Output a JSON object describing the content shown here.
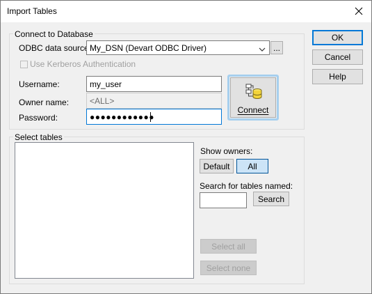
{
  "window": {
    "title": "Import Tables"
  },
  "dialog_buttons": {
    "ok": "OK",
    "cancel": "Cancel",
    "help": "Help"
  },
  "connect_group": {
    "title": "Connect to Database",
    "odbc_label": "ODBC data source:",
    "odbc_value": "My_DSN (Devart ODBC Driver)",
    "browse_label": "...",
    "kerberos_label": "Use Kerberos Authentication",
    "kerberos_checked": false,
    "username_label": "Username:",
    "username_value": "my_user",
    "owner_label": "Owner name:",
    "owner_value": "<ALL>",
    "password_label": "Password:",
    "password_mask": "●●●●●●●●●●●●",
    "connect_label": "Connect"
  },
  "select_group": {
    "title": "Select tables",
    "show_owners_label": "Show owners:",
    "default_label": "Default",
    "all_label": "All",
    "search_label": "Search for tables named:",
    "search_value": "",
    "search_button": "Search",
    "select_all": "Select all",
    "select_none": "Select none"
  },
  "colors": {
    "accent": "#0078d7",
    "pressed": "#cce4f7",
    "connect_highlight": "#a6cfee"
  }
}
